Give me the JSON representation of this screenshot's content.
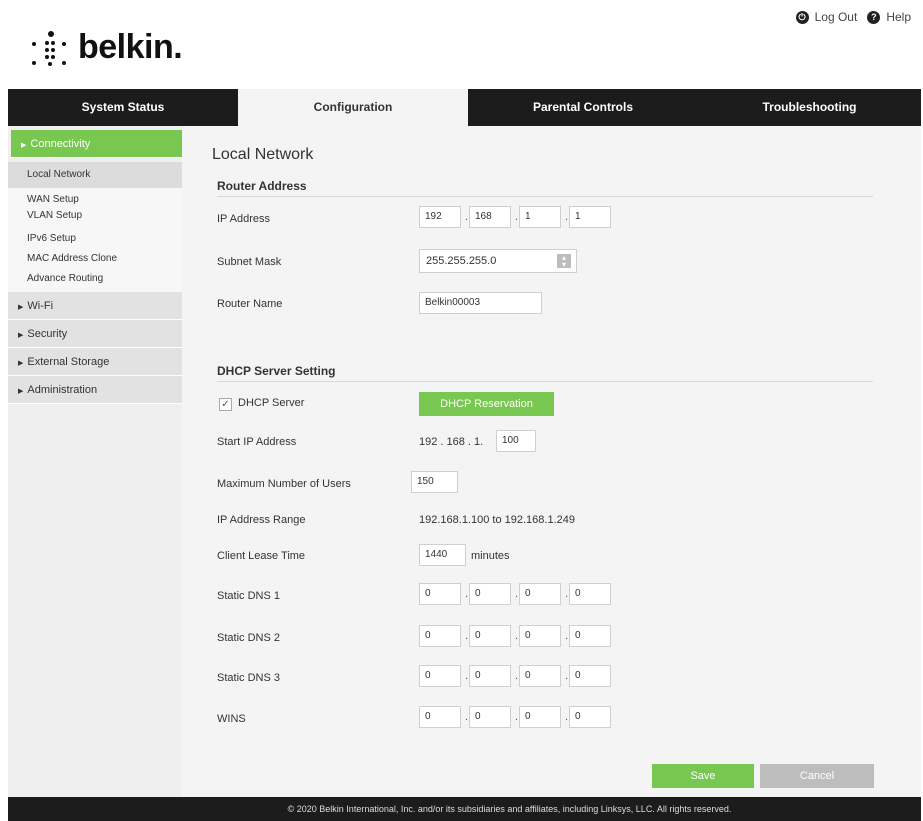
{
  "header": {
    "logout": {
      "icon": "power-icon",
      "label": "Log Out"
    },
    "help": {
      "icon": "help-icon",
      "label": "Help"
    }
  },
  "logo": {
    "text": "belkin",
    "suffix": "."
  },
  "tabs": [
    {
      "label": "System Status",
      "active": false
    },
    {
      "label": "Configuration",
      "active": true
    },
    {
      "label": "Parental Controls",
      "active": false
    },
    {
      "label": "Troubleshooting",
      "active": false
    }
  ],
  "sidebar": {
    "connectivity": "Connectivity",
    "subitems": [
      "Local Network",
      "WAN Setup",
      "VLAN Setup",
      "IPv6 Setup",
      "MAC Address Clone",
      "Advance Routing"
    ],
    "sections": [
      "Wi-Fi",
      "Security",
      "External Storage",
      "Administration"
    ]
  },
  "page": {
    "title": "Local Network",
    "router_address": {
      "title": "Router Address",
      "ip_label": "IP Address",
      "ip": [
        "192",
        "168",
        "1",
        "1"
      ],
      "subnet_label": "Subnet Mask",
      "subnet": "255.255.255.0",
      "name_label": "Router Name",
      "name": "Belkin00003"
    },
    "dhcp": {
      "title": "DHCP Server Setting",
      "server_label": "DHCP Server",
      "server_enabled": true,
      "reservation_button": "DHCP Reservation",
      "start_label": "Start IP Address",
      "start_prefix": "192 . 168 . 1.",
      "start_last": "100",
      "max_users_label": "Maximum Number of Users",
      "max_users": "150",
      "range_label": "IP Address Range",
      "range": "192.168.1.100 to 192.168.1.249",
      "lease_label": "Client Lease Time",
      "lease": "1440",
      "lease_unit": "minutes",
      "dns1_label": "Static DNS 1",
      "dns1": [
        "0",
        "0",
        "0",
        "0"
      ],
      "dns2_label": "Static DNS 2",
      "dns2": [
        "0",
        "0",
        "0",
        "0"
      ],
      "dns3_label": "Static DNS 3",
      "dns3": [
        "0",
        "0",
        "0",
        "0"
      ],
      "wins_label": "WINS",
      "wins": [
        "0",
        "0",
        "0",
        "0"
      ]
    },
    "save_button": "Save",
    "cancel_button": "Cancel"
  },
  "footer": "© 2020 Belkin International, Inc. and/or its subsidiaries and affiliates, including Linksys, LLC. All rights reserved.",
  "colors": {
    "accent_green": "#78c751",
    "dark_bar": "#1c1c1c",
    "button_gray": "#bdbdbd"
  }
}
